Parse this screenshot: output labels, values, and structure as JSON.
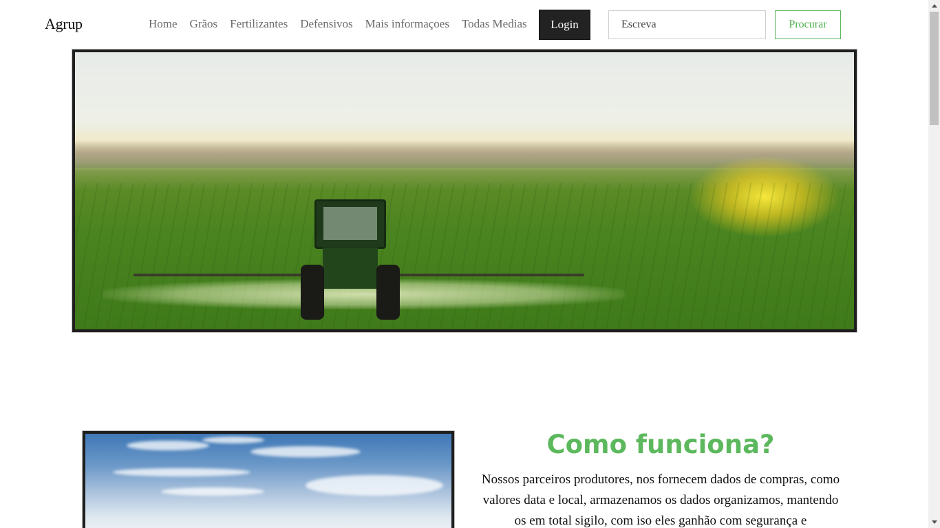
{
  "navbar": {
    "brand": "Agrup",
    "links": [
      "Home",
      "Grãos",
      "Fertilizantes",
      "Defensivos",
      "Mais informaçoes",
      "Todas Medias"
    ],
    "login_label": "Login",
    "search_placeholder": "Escreva",
    "search_button": "Procurar"
  },
  "how": {
    "title": "Como funciona?",
    "text": "Nossos parceiros produtores, nos fornecem dados de compras, como valores data e local, armazenamos os dados organizamos, mantendo os em total sigilo, com iso eles ganhão com segurança e"
  },
  "colors": {
    "accent_green": "#5cb85c",
    "login_bg": "#222222"
  }
}
